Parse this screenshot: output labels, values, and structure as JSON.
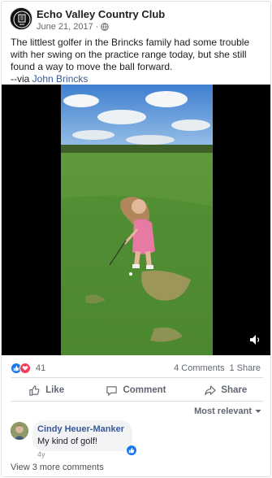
{
  "post": {
    "page_name": "Echo Valley Country Club",
    "date": "June 21, 2017",
    "separator": "·",
    "text": "The littlest golfer in the Brincks family had some trouble with her swing on the practice range today, but she still found a way to move the ball forward.",
    "via_prefix": "--via ",
    "via_name": "John Brincks"
  },
  "stats": {
    "reaction_count": "41",
    "comments": "4 Comments",
    "shares": "1 Share"
  },
  "actions": {
    "like": "Like",
    "comment": "Comment",
    "share": "Share"
  },
  "sort": {
    "label": "Most relevant"
  },
  "comment": {
    "author": "Cindy Heuer-Manker",
    "text": "My kind of golf!",
    "time": "4y"
  },
  "more_comments": "View 3 more comments",
  "colors": {
    "link": "#385898",
    "like_blue": "#1877f2",
    "love_red": "#f33e58",
    "muted": "#606770"
  },
  "icons": [
    "page-avatar-icon",
    "globe-icon",
    "like-reaction-icon",
    "love-reaction-icon",
    "like-icon",
    "comment-icon",
    "share-icon",
    "chevron-down-icon",
    "volume-icon"
  ]
}
